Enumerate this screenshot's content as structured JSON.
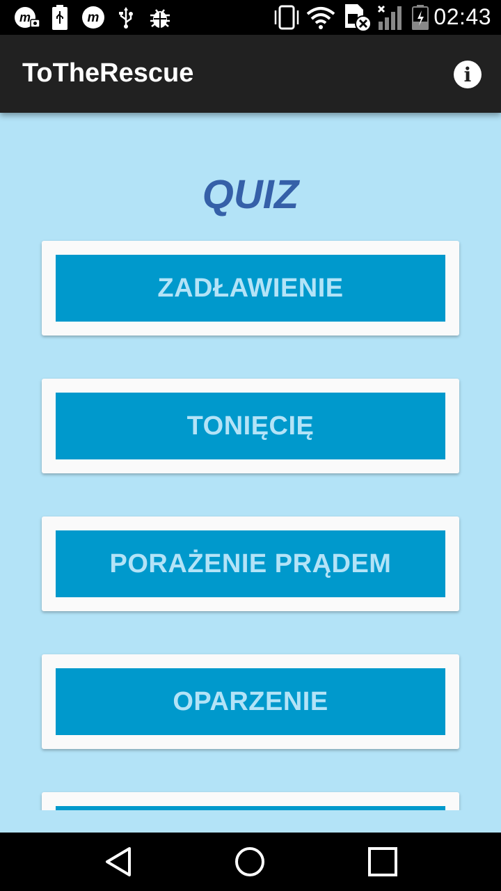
{
  "status_bar": {
    "time": "02:43",
    "icons": [
      "m-camera-icon",
      "battery-usb-icon",
      "m-icon",
      "usb-icon",
      "bug-icon",
      "vibrate-icon",
      "wifi-icon",
      "sim-off-icon",
      "signal-icon",
      "battery-charging-icon"
    ]
  },
  "app_bar": {
    "title": "ToTheRescue",
    "info_icon": "info-icon",
    "info_glyph": "i"
  },
  "main": {
    "heading": "QUIZ",
    "items": [
      {
        "label": "ZADŁAWIENIE"
      },
      {
        "label": "TONIĘCIĘ"
      },
      {
        "label": "PORAŻENIE PRĄDEM"
      },
      {
        "label": "OPARZENIE"
      },
      {
        "label": ""
      }
    ]
  },
  "nav_bar": {
    "icons": [
      "back-icon",
      "home-icon",
      "recents-icon"
    ]
  },
  "colors": {
    "background": "#b3e3f7",
    "app_bar": "#212121",
    "accent_button": "#0099cc",
    "heading": "#3560a8",
    "card": "#fafafa"
  }
}
